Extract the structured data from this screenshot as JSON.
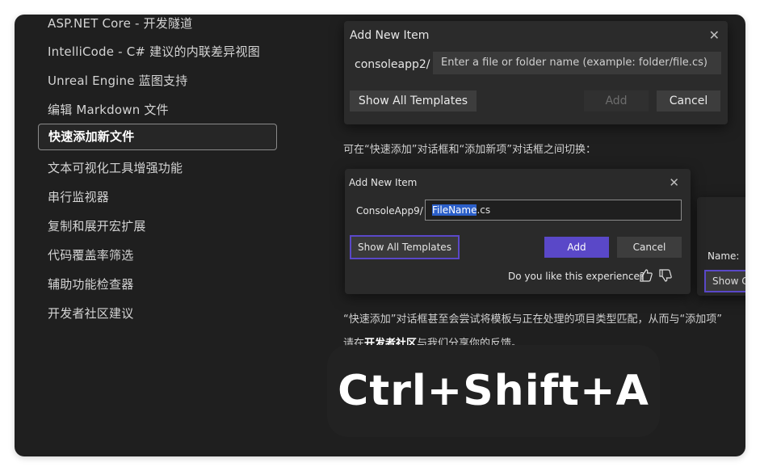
{
  "sidebar": {
    "items": [
      {
        "label": "ASP.NET Core - 开发隧道"
      },
      {
        "label": "IntelliCode - C# 建议的内联差异视图"
      },
      {
        "label": "Unreal Engine 蓝图支持"
      },
      {
        "label": "编辑 Markdown 文件"
      },
      {
        "label": "快速添加新文件"
      },
      {
        "label": "文本可视化工具增强功能"
      },
      {
        "label": "串行监视器"
      },
      {
        "label": "复制和展开宏扩展"
      },
      {
        "label": "代码覆盖率筛选"
      },
      {
        "label": "辅助功能检查器"
      },
      {
        "label": "开发者社区建议"
      }
    ]
  },
  "dialog1": {
    "title": "Add New Item",
    "path_label": "consoleapp2/",
    "input_placeholder": "Enter a file or folder name (example: folder/file.cs)",
    "show_all_label": "Show All Templates",
    "add_label": "Add",
    "cancel_label": "Cancel"
  },
  "switch_text": "可在“快速添加”对话框和“添加新项”对话框之间切换：",
  "dialog2": {
    "title": "Add New Item",
    "path_label": "ConsoleApp9/",
    "input_selected": "FileName",
    "input_rest": ".cs",
    "show_all_label": "Show All Templates",
    "add_label": "Add",
    "cancel_label": "Cancel",
    "feedback_question": "Do you like this experience?"
  },
  "partial_dialog": {
    "name_label": "Name:",
    "button_partial": "Show C"
  },
  "bottom_para": {
    "line1": "“快速添加”对话框甚至会尝试将模板与正在处理的项目类型匹配，从而与“添加项”",
    "line2_prefix": "请在",
    "line2_link": "开发者社区",
    "line2_suffix": "与我们分享你的反馈。"
  },
  "shortcut": "Ctrl+Shift+A",
  "colors": {
    "background": "#1f1f1f",
    "accent": "#5a48c8",
    "selection": "#2b5fc9"
  },
  "icons": [
    "close-icon",
    "thumbs-up-icon",
    "thumbs-down-icon"
  ]
}
